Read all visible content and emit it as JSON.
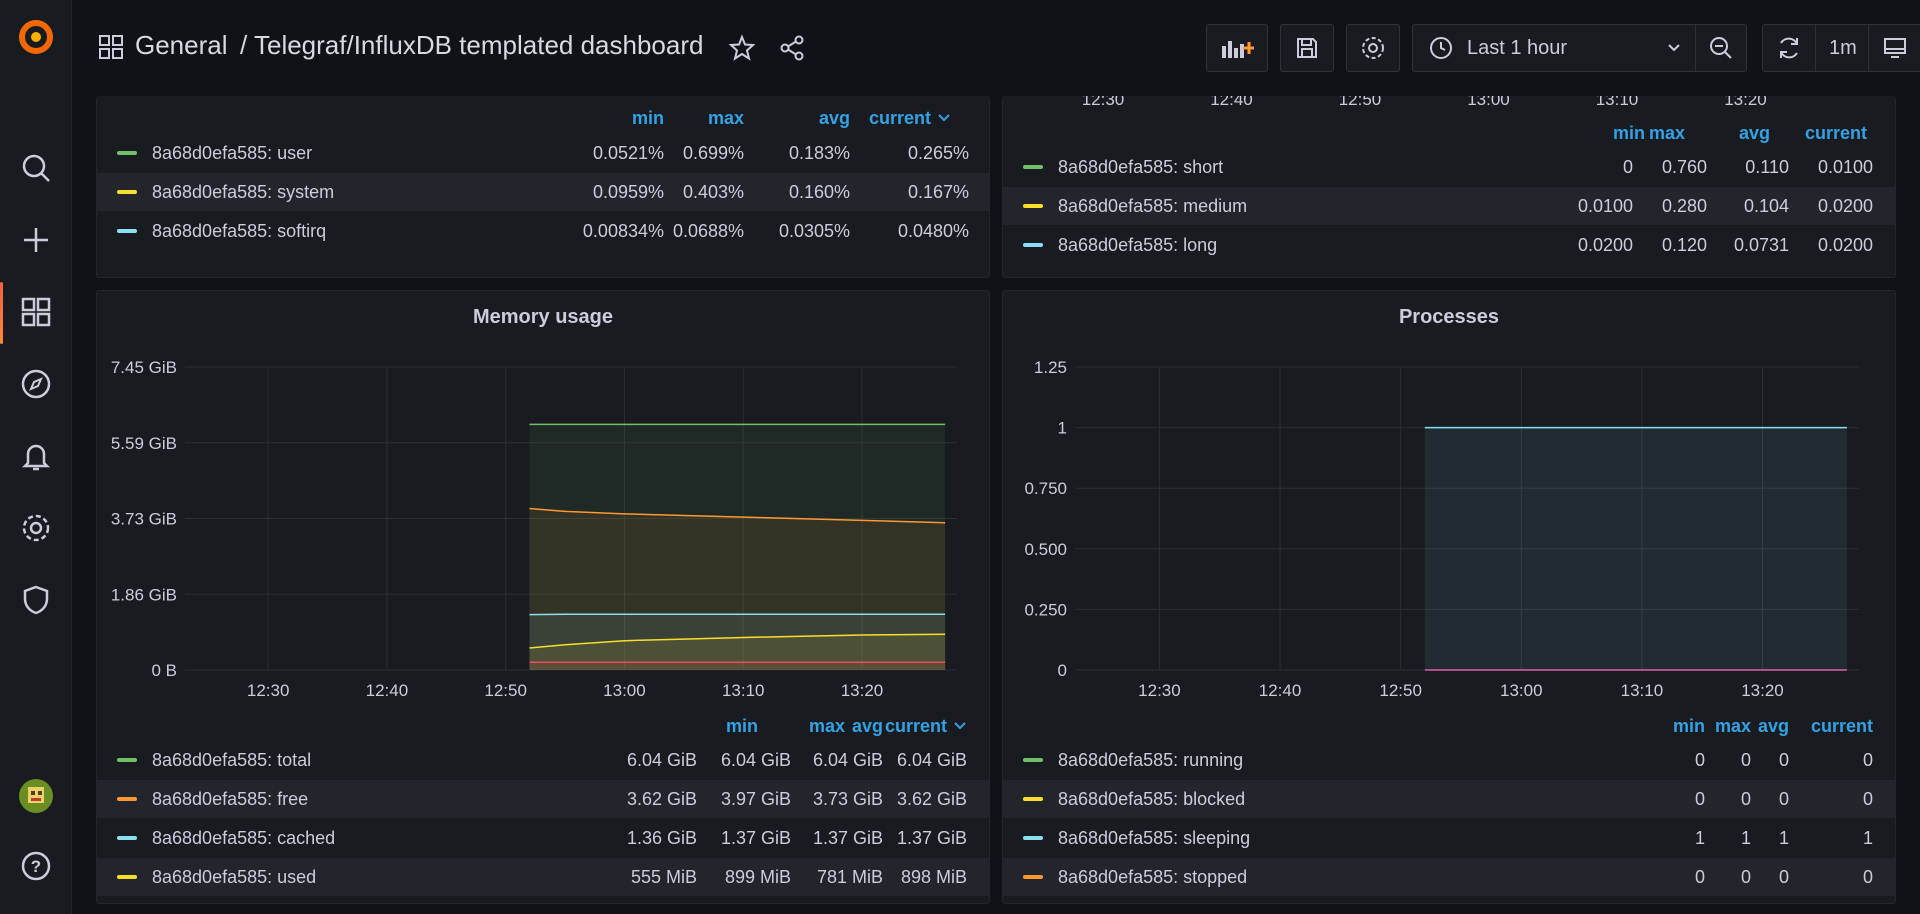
{
  "header": {
    "folder": "General",
    "title": "/ Telegraf/InfluxDB templated dashboard",
    "time_range": "Last 1 hour",
    "refresh_interval": "1m"
  },
  "colors": {
    "green": "#73bf69",
    "yellow": "#fade2a",
    "cyan": "#8ae0f2",
    "orange": "#ff9830",
    "red": "#f2495c",
    "pink": "#e05fa6",
    "blue": "#33a2e5"
  },
  "cpu_panel": {
    "headers": [
      "min",
      "max",
      "avg",
      "current"
    ],
    "rows": [
      {
        "name": "8a68d0efa585: user",
        "color": "#73bf69",
        "values": [
          "0.0521%",
          "0.699%",
          "0.183%",
          "0.265%"
        ]
      },
      {
        "name": "8a68d0efa585: system",
        "color": "#fade2a",
        "values": [
          "0.0959%",
          "0.403%",
          "0.160%",
          "0.167%"
        ]
      },
      {
        "name": "8a68d0efa585: softirq",
        "color": "#8ae0f2",
        "values": [
          "0.00834%",
          "0.0688%",
          "0.0305%",
          "0.0480%"
        ]
      }
    ]
  },
  "load_panel": {
    "x_ticks": [
      "12:30",
      "12:40",
      "12:50",
      "13:00",
      "13:10",
      "13:20"
    ],
    "headers": [
      "min",
      "max",
      "avg",
      "current"
    ],
    "rows": [
      {
        "name": "8a68d0efa585: short",
        "color": "#73bf69",
        "values": [
          "0",
          "0.760",
          "0.110",
          "0.0100"
        ]
      },
      {
        "name": "8a68d0efa585: medium",
        "color": "#fade2a",
        "values": [
          "0.0100",
          "0.280",
          "0.104",
          "0.0200"
        ]
      },
      {
        "name": "8a68d0efa585: long",
        "color": "#8ae0f2",
        "values": [
          "0.0200",
          "0.120",
          "0.0731",
          "0.0200"
        ]
      }
    ]
  },
  "memory_panel": {
    "title": "Memory usage",
    "headers": [
      "min",
      "max",
      "avg",
      "current"
    ],
    "rows": [
      {
        "name": "8a68d0efa585: total",
        "color": "#73bf69",
        "values": [
          "6.04 GiB",
          "6.04 GiB",
          "6.04 GiB",
          "6.04 GiB"
        ]
      },
      {
        "name": "8a68d0efa585: free",
        "color": "#ff9830",
        "values": [
          "3.62 GiB",
          "3.97 GiB",
          "3.73 GiB",
          "3.62 GiB"
        ]
      },
      {
        "name": "8a68d0efa585: cached",
        "color": "#8ae0f2",
        "values": [
          "1.36 GiB",
          "1.37 GiB",
          "1.37 GiB",
          "1.37 GiB"
        ]
      },
      {
        "name": "8a68d0efa585: used",
        "color": "#fade2a",
        "values": [
          "555 MiB",
          "899 MiB",
          "781 MiB",
          "898 MiB"
        ]
      }
    ]
  },
  "processes_panel": {
    "title": "Processes",
    "headers": [
      "min",
      "max",
      "avg",
      "current"
    ],
    "rows": [
      {
        "name": "8a68d0efa585: running",
        "color": "#73bf69",
        "values": [
          "0",
          "0",
          "0",
          "0"
        ]
      },
      {
        "name": "8a68d0efa585: blocked",
        "color": "#fade2a",
        "values": [
          "0",
          "0",
          "0",
          "0"
        ]
      },
      {
        "name": "8a68d0efa585: sleeping",
        "color": "#8ae0f2",
        "values": [
          "1",
          "1",
          "1",
          "1"
        ]
      },
      {
        "name": "8a68d0efa585: stopped",
        "color": "#ff9830",
        "values": [
          "0",
          "0",
          "0",
          "0"
        ]
      }
    ]
  },
  "chart_data": [
    {
      "type": "area",
      "title": "Memory usage",
      "x": [
        "12:52",
        "12:55",
        "13:00",
        "13:05",
        "13:10",
        "13:15",
        "13:20",
        "13:27"
      ],
      "x_ticks": [
        "12:30",
        "12:40",
        "12:50",
        "13:00",
        "13:10",
        "13:20"
      ],
      "y_ticks": [
        "0 B",
        "1.86 GiB",
        "3.73 GiB",
        "5.59 GiB",
        "7.45 GiB"
      ],
      "ylim": [
        0,
        7.45
      ],
      "xlim": [
        "12:23",
        "13:28"
      ],
      "grid": true,
      "series": [
        {
          "name": "8a68d0efa585: total",
          "color": "#73bf69",
          "values": [
            6.04,
            6.04,
            6.04,
            6.04,
            6.04,
            6.04,
            6.04,
            6.04
          ]
        },
        {
          "name": "8a68d0efa585: free",
          "color": "#ff9830",
          "values": [
            3.97,
            3.9,
            3.84,
            3.8,
            3.76,
            3.72,
            3.68,
            3.62
          ]
        },
        {
          "name": "8a68d0efa585: cached",
          "color": "#8ae0f2",
          "values": [
            1.36,
            1.37,
            1.37,
            1.37,
            1.37,
            1.37,
            1.37,
            1.37
          ]
        },
        {
          "name": "8a68d0efa585: used",
          "color": "#fade2a",
          "values": [
            0.54,
            0.62,
            0.72,
            0.76,
            0.8,
            0.83,
            0.86,
            0.88
          ]
        },
        {
          "color": "#f2495c",
          "values": [
            0.19,
            0.19,
            0.19,
            0.19,
            0.19,
            0.19,
            0.19,
            0.19
          ]
        }
      ]
    },
    {
      "type": "area",
      "title": "Processes",
      "x": [
        "12:52",
        "13:27"
      ],
      "x_ticks": [
        "12:30",
        "12:40",
        "12:50",
        "13:00",
        "13:10",
        "13:20"
      ],
      "y_ticks": [
        "0",
        "0.250",
        "0.500",
        "0.750",
        "1",
        "1.25"
      ],
      "ylim": [
        0,
        1.25
      ],
      "xlim": [
        "12:23",
        "13:28"
      ],
      "grid": true,
      "series": [
        {
          "name": "8a68d0efa585: sleeping",
          "color": "#8ae0f2",
          "values": [
            1,
            1
          ]
        },
        {
          "color": "#e05fa6",
          "values": [
            0,
            0
          ]
        }
      ]
    }
  ]
}
